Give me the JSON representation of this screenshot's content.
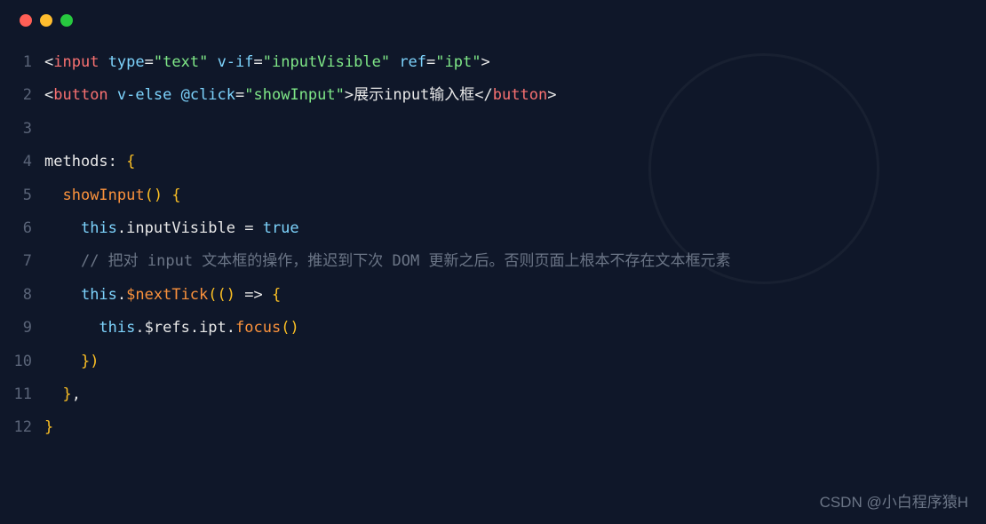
{
  "window": {
    "close": "close",
    "minimize": "minimize",
    "maximize": "maximize"
  },
  "code": {
    "lines": [
      {
        "num": "1",
        "tokens": [
          {
            "t": "<",
            "c": "tok-white"
          },
          {
            "t": "input",
            "c": "tok-red"
          },
          {
            "t": " ",
            "c": "tok-white"
          },
          {
            "t": "type",
            "c": "tok-cyan"
          },
          {
            "t": "=",
            "c": "tok-white"
          },
          {
            "t": "\"text\"",
            "c": "tok-green"
          },
          {
            "t": " ",
            "c": "tok-white"
          },
          {
            "t": "v-if",
            "c": "tok-cyan"
          },
          {
            "t": "=",
            "c": "tok-white"
          },
          {
            "t": "\"inputVisible\"",
            "c": "tok-green"
          },
          {
            "t": " ",
            "c": "tok-white"
          },
          {
            "t": "ref",
            "c": "tok-cyan"
          },
          {
            "t": "=",
            "c": "tok-white"
          },
          {
            "t": "\"ipt\"",
            "c": "tok-green"
          },
          {
            "t": ">",
            "c": "tok-white"
          }
        ]
      },
      {
        "num": "2",
        "tokens": [
          {
            "t": "<",
            "c": "tok-white"
          },
          {
            "t": "button",
            "c": "tok-red"
          },
          {
            "t": " ",
            "c": "tok-white"
          },
          {
            "t": "v-else",
            "c": "tok-cyan"
          },
          {
            "t": " ",
            "c": "tok-white"
          },
          {
            "t": "@click",
            "c": "tok-cyan"
          },
          {
            "t": "=",
            "c": "tok-white"
          },
          {
            "t": "\"showInput\"",
            "c": "tok-green"
          },
          {
            "t": ">",
            "c": "tok-white"
          },
          {
            "t": "展示input输入框",
            "c": "tok-white"
          },
          {
            "t": "</",
            "c": "tok-white"
          },
          {
            "t": "button",
            "c": "tok-red"
          },
          {
            "t": ">",
            "c": "tok-white"
          }
        ]
      },
      {
        "num": "3",
        "tokens": []
      },
      {
        "num": "4",
        "tokens": [
          {
            "t": "methods",
            "c": "tok-white"
          },
          {
            "t": ":",
            "c": "tok-white"
          },
          {
            "t": " ",
            "c": "tok-white"
          },
          {
            "t": "{",
            "c": "tok-yellow"
          }
        ]
      },
      {
        "num": "5",
        "tokens": [
          {
            "t": "  ",
            "c": "tok-white"
          },
          {
            "t": "showInput",
            "c": "tok-orange"
          },
          {
            "t": "()",
            "c": "tok-yellow"
          },
          {
            "t": " ",
            "c": "tok-white"
          },
          {
            "t": "{",
            "c": "tok-yellow"
          }
        ]
      },
      {
        "num": "6",
        "tokens": [
          {
            "t": "    ",
            "c": "tok-white"
          },
          {
            "t": "this",
            "c": "tok-cyan"
          },
          {
            "t": ".",
            "c": "tok-white"
          },
          {
            "t": "inputVisible",
            "c": "tok-white"
          },
          {
            "t": " = ",
            "c": "tok-white"
          },
          {
            "t": "true",
            "c": "tok-cyan"
          }
        ]
      },
      {
        "num": "7",
        "tokens": [
          {
            "t": "    ",
            "c": "tok-white"
          },
          {
            "t": "// 把对 input 文本框的操作，推迟到下次 DOM 更新之后。否则页面上根本不存在文本框元素",
            "c": "tok-comment"
          }
        ]
      },
      {
        "num": "8",
        "tokens": [
          {
            "t": "    ",
            "c": "tok-white"
          },
          {
            "t": "this",
            "c": "tok-cyan"
          },
          {
            "t": ".",
            "c": "tok-white"
          },
          {
            "t": "$nextTick",
            "c": "tok-orange"
          },
          {
            "t": "((",
            "c": "tok-yellow"
          },
          {
            "t": ")",
            "c": "tok-yellow"
          },
          {
            "t": " => ",
            "c": "tok-white"
          },
          {
            "t": "{",
            "c": "tok-yellow"
          }
        ]
      },
      {
        "num": "9",
        "tokens": [
          {
            "t": "      ",
            "c": "tok-white"
          },
          {
            "t": "this",
            "c": "tok-cyan"
          },
          {
            "t": ".",
            "c": "tok-white"
          },
          {
            "t": "$refs",
            "c": "tok-white"
          },
          {
            "t": ".",
            "c": "tok-white"
          },
          {
            "t": "ipt",
            "c": "tok-white"
          },
          {
            "t": ".",
            "c": "tok-white"
          },
          {
            "t": "focus",
            "c": "tok-orange"
          },
          {
            "t": "()",
            "c": "tok-yellow"
          }
        ]
      },
      {
        "num": "10",
        "tokens": [
          {
            "t": "    ",
            "c": "tok-white"
          },
          {
            "t": "})",
            "c": "tok-yellow"
          }
        ]
      },
      {
        "num": "11",
        "tokens": [
          {
            "t": "  ",
            "c": "tok-white"
          },
          {
            "t": "}",
            "c": "tok-yellow"
          },
          {
            "t": ",",
            "c": "tok-white"
          }
        ]
      },
      {
        "num": "12",
        "tokens": [
          {
            "t": "}",
            "c": "tok-yellow"
          }
        ]
      }
    ]
  },
  "watermark": "CSDN @小白程序猿H"
}
